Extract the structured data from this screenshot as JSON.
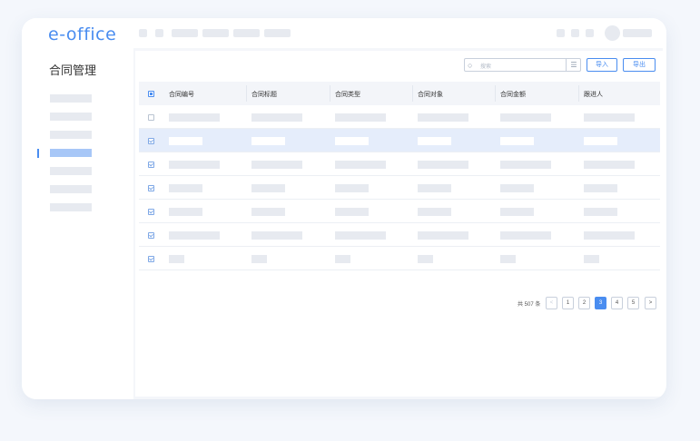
{
  "app": {
    "logo": "e-office"
  },
  "sidebar": {
    "title": "合同管理"
  },
  "toolbar": {
    "search_placeholder": "搜索",
    "search_icon": "search-icon",
    "filter_icon": "filter-icon",
    "import_label": "导入",
    "export_label": "导出"
  },
  "table": {
    "columns": [
      "合同编号",
      "合同标题",
      "合同类型",
      "合同对象",
      "合同金额",
      "跟进人"
    ],
    "header_checkbox": "partial",
    "rows": [
      {
        "checked": false,
        "selected": false
      },
      {
        "checked": true,
        "selected": true
      },
      {
        "checked": true,
        "selected": false
      },
      {
        "checked": true,
        "selected": false
      },
      {
        "checked": true,
        "selected": false
      },
      {
        "checked": true,
        "selected": false
      },
      {
        "checked": true,
        "selected": false
      }
    ]
  },
  "pagination": {
    "total_text": "共 507 条",
    "prev_icon": "chevron-left-icon",
    "next_icon": "chevron-right-icon",
    "pages": [
      "1",
      "2",
      "3",
      "4",
      "5"
    ],
    "current": "3"
  },
  "colors": {
    "accent": "#4a8df0",
    "selected_row": "#e5edfb",
    "placeholder": "#e7eaf0"
  }
}
